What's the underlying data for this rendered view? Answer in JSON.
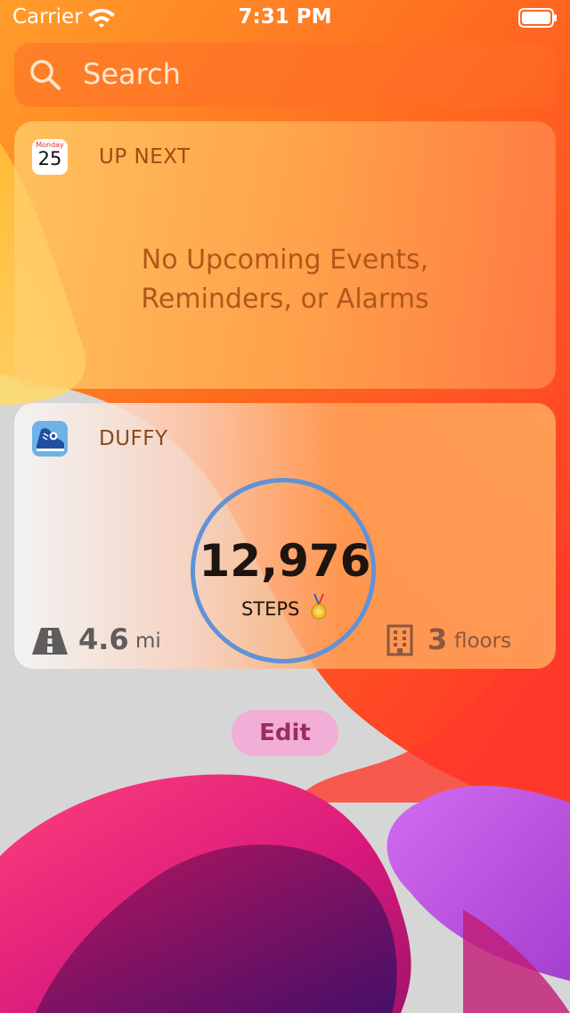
{
  "status_bar": {
    "carrier": "Carrier",
    "time": "7:31 PM",
    "wifi_icon": "wifi-icon",
    "battery_icon": "battery-icon"
  },
  "search": {
    "placeholder": "Search",
    "icon": "search-icon"
  },
  "widgets": {
    "up_next": {
      "title": "UP NEXT",
      "icon": "calendar-icon",
      "icon_day": "Monday",
      "icon_date": "25",
      "message_line1": "No Upcoming Events,",
      "message_line2": "Reminders, or Alarms"
    },
    "duffy": {
      "title": "DUFFY",
      "icon": "sneaker-icon",
      "steps_value": "12,976",
      "steps_label": "STEPS",
      "medal_icon": "medal-icon",
      "distance_icon": "road-icon",
      "distance_value": "4.6",
      "distance_unit": "mi",
      "floors_icon": "building-icon",
      "floors_value": "3",
      "floors_unit": "floors",
      "ring_color": "#5f93d6"
    }
  },
  "edit_button": {
    "label": "Edit"
  },
  "colors": {
    "wallpaper_orange": "#ff7a1e",
    "wallpaper_red": "#ff2a2a",
    "wallpaper_magenta": "#c2185b",
    "wallpaper_purple": "#3d1466",
    "edit_text": "#9a2e5e"
  }
}
